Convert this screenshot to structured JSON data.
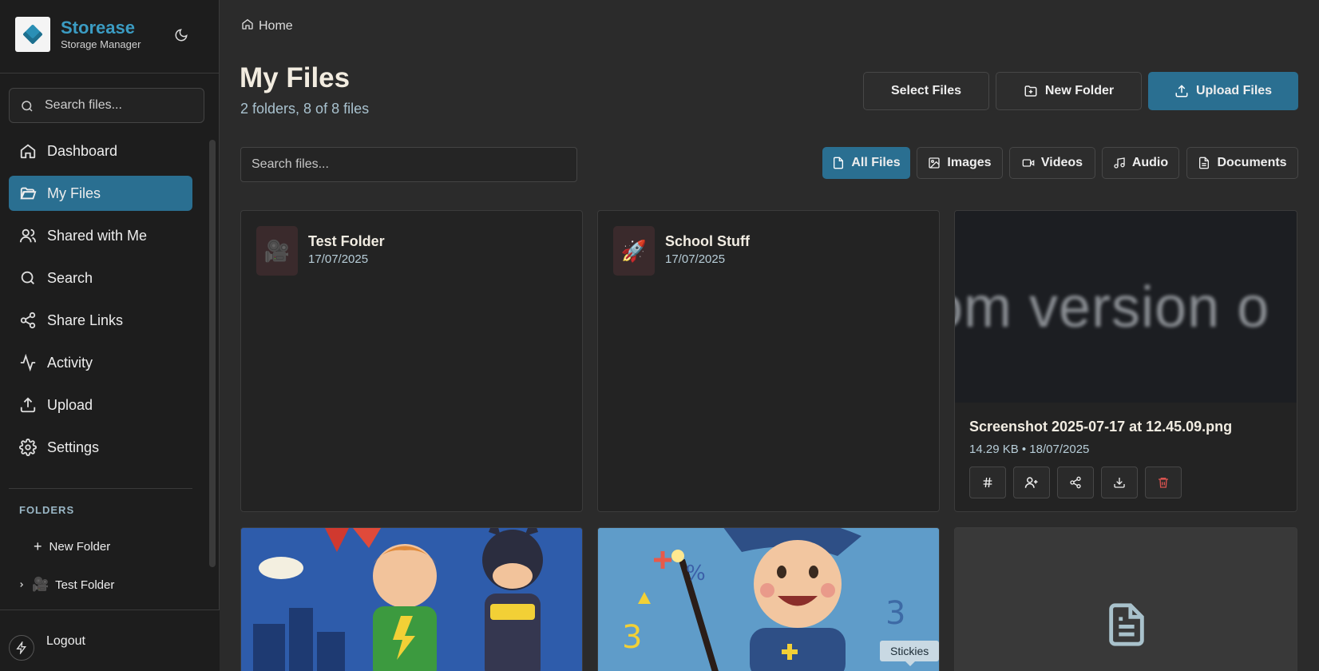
{
  "app": {
    "name": "Storease",
    "subtitle": "Storage Manager"
  },
  "sidebar": {
    "search_placeholder": "Search files...",
    "items": [
      {
        "label": "Dashboard",
        "icon": "home-icon"
      },
      {
        "label": "My Files",
        "icon": "folder-open-icon",
        "active": true
      },
      {
        "label": "Shared with Me",
        "icon": "users-icon"
      },
      {
        "label": "Search",
        "icon": "search-icon"
      },
      {
        "label": "Share Links",
        "icon": "share-icon"
      },
      {
        "label": "Activity",
        "icon": "activity-icon"
      },
      {
        "label": "Upload",
        "icon": "upload-icon"
      },
      {
        "label": "Settings",
        "icon": "gear-icon"
      }
    ],
    "folders_title": "FOLDERS",
    "new_folder": "New Folder",
    "tree": [
      {
        "label": "Test Folder",
        "emoji": "🎥"
      }
    ],
    "logout": "Logout"
  },
  "breadcrumb": {
    "home": "Home"
  },
  "header": {
    "title": "My Files",
    "subtitle": "2 folders, 8 of 8 files",
    "select_files": "Select Files",
    "new_folder": "New Folder",
    "upload_files": "Upload Files"
  },
  "main_search": {
    "placeholder": "Search files..."
  },
  "filters": [
    "All Files",
    "Images",
    "Videos",
    "Audio",
    "Documents"
  ],
  "folders": [
    {
      "name": "Test Folder",
      "date": "17/07/2025",
      "emoji": "🎥"
    },
    {
      "name": "School Stuff",
      "date": "17/07/2025",
      "emoji": "🚀"
    }
  ],
  "files": [
    {
      "name": "Screenshot 2025-07-17 at 12.45.09.png",
      "meta": "14.29 KB • 18/07/2025",
      "preview_text": "om version o"
    }
  ],
  "tooltip": "Stickies",
  "colors": {
    "accent": "#2a6f91",
    "brand": "#3b9cc3",
    "danger": "#d9534f"
  }
}
